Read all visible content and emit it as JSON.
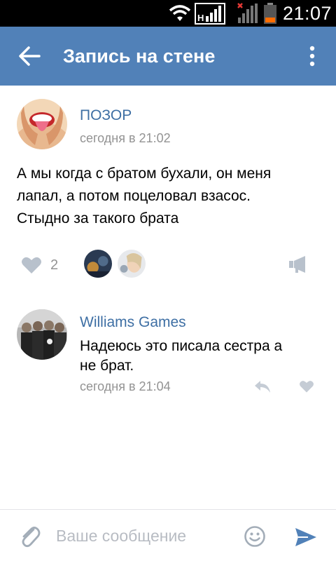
{
  "status_bar": {
    "time": "21:07"
  },
  "header": {
    "title": "Запись на стене",
    "color": "#5181b8"
  },
  "post": {
    "author": "ПОЗОР",
    "time": "сегодня в 21:02",
    "text_lines": [
      "А мы когда с братом бухали, он меня",
      "лапал, а потом поцеловал взасос.",
      "Стыдно за такого брата"
    ],
    "like_count": "2"
  },
  "comment": {
    "author": "Williams Games",
    "text_lines": [
      "Надеюсь это писала сестра а",
      "не брат."
    ],
    "time": "сегодня в 21:04"
  },
  "input": {
    "placeholder": "Ваше сообщение",
    "value": ""
  },
  "colors": {
    "link": "#3e6fa4",
    "meta": "#939393",
    "icon": "#b8c1cc",
    "send": "#5181b8"
  }
}
